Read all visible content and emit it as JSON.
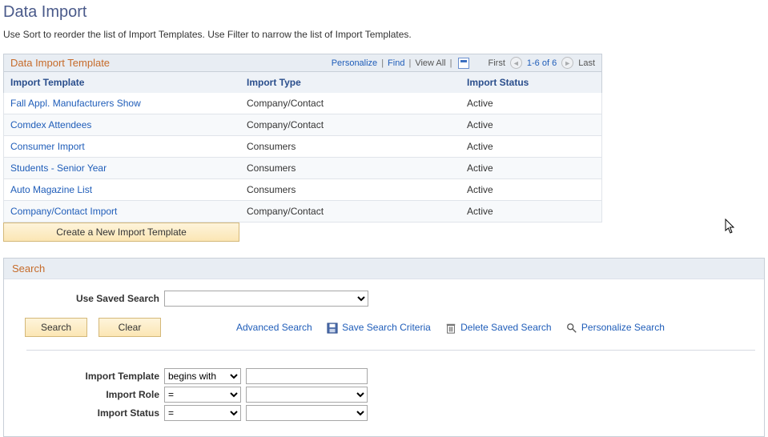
{
  "page": {
    "title": "Data Import",
    "instructions": "Use Sort to reorder the list of Import Templates. Use Filter to narrow the list of Import Templates."
  },
  "grid": {
    "title": "Data Import Template",
    "tools": {
      "personalize": "Personalize",
      "find": "Find",
      "viewall": "View All"
    },
    "nav": {
      "first": "First",
      "last": "Last",
      "range": "1-6 of 6"
    },
    "columns": {
      "c1": "Import Template",
      "c2": "Import Type",
      "c3": "Import Status"
    },
    "rows": [
      {
        "template": "Fall Appl. Manufacturers Show",
        "type": "Company/Contact",
        "status": "Active"
      },
      {
        "template": "Comdex Attendees",
        "type": "Company/Contact",
        "status": "Active"
      },
      {
        "template": "Consumer Import",
        "type": "Consumers",
        "status": "Active"
      },
      {
        "template": "Students - Senior Year",
        "type": "Consumers",
        "status": "Active"
      },
      {
        "template": "Auto Magazine List",
        "type": "Consumers",
        "status": "Active"
      },
      {
        "template": "Company/Contact Import",
        "type": "Company/Contact",
        "status": "Active"
      }
    ],
    "create_button": "Create a New Import Template"
  },
  "search": {
    "title": "Search",
    "saved_label": "Use Saved Search",
    "search_btn": "Search",
    "clear_btn": "Clear",
    "advanced": "Advanced Search",
    "save_criteria": "Save Search Criteria",
    "delete_saved": "Delete Saved Search",
    "personalize_search": "Personalize Search",
    "criteria": {
      "template_label": "Import Template",
      "template_op": "begins with",
      "role_label": "Import Role",
      "role_op": "=",
      "status_label": "Import Status",
      "status_op": "="
    }
  }
}
